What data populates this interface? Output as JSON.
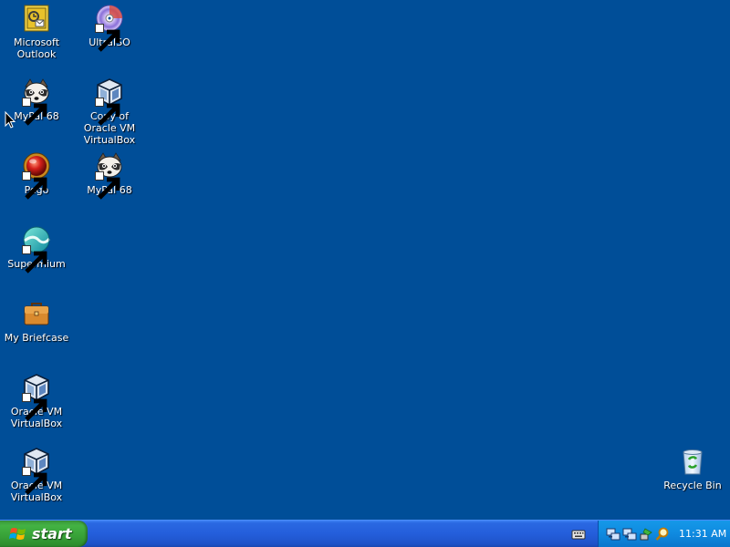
{
  "desktop": {
    "background": "#004e98",
    "icons": [
      {
        "label": "Microsoft Outlook",
        "icon": "outlook-icon",
        "shortcut": false
      },
      {
        "label": "UltraISO",
        "icon": "ultraiso-icon",
        "shortcut": true
      },
      {
        "label": "MyPal 68",
        "icon": "mypal-icon",
        "shortcut": true
      },
      {
        "label": "Copy of Oracle VM VirtualBox",
        "icon": "virtualbox-icon",
        "shortcut": true
      },
      {
        "label": "Pego",
        "icon": "pego-icon",
        "shortcut": true
      },
      {
        "label": "MyPal 68",
        "icon": "mypal-icon",
        "shortcut": true
      },
      {
        "label": "Supermium",
        "icon": "supermium-icon",
        "shortcut": true
      },
      {
        "label": "My Briefcase",
        "icon": "briefcase-icon",
        "shortcut": false
      },
      {
        "label": "Oracle VM VirtualBox",
        "icon": "virtualbox-icon",
        "shortcut": true
      },
      {
        "label": "Oracle VM VirtualBox",
        "icon": "virtualbox-icon",
        "shortcut": true
      },
      {
        "label": "Recycle Bin",
        "icon": "recycle-bin-icon",
        "shortcut": false
      }
    ]
  },
  "taskbar": {
    "start_label": "start",
    "clock": "11:31 AM",
    "tray_icons": [
      "network-icon",
      "network-icon",
      "safely-remove-icon",
      "search-icon"
    ]
  }
}
